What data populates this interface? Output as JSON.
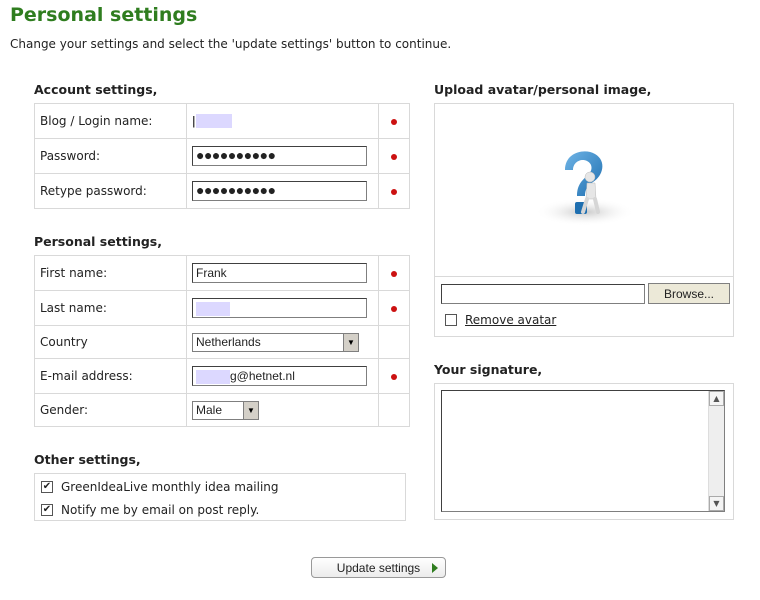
{
  "page": {
    "title": "Personal settings",
    "intro": "Change your settings and select the 'update settings' button to continue."
  },
  "account": {
    "heading": "Account settings,",
    "login_label": "Blog / Login name:",
    "login_value": "",
    "password_label": "Password:",
    "password_value": "●●●●●●●●●●",
    "retype_label": "Retype password:",
    "retype_value": "●●●●●●●●●●"
  },
  "personal": {
    "heading": "Personal settings,",
    "first_name_label": "First name:",
    "first_name_value": "Frank",
    "last_name_label": "Last name:",
    "country_label": "Country",
    "country_value": "Netherlands",
    "email_label": "E-mail address:",
    "email_suffix": "g@hetnet.nl",
    "gender_label": "Gender:",
    "gender_value": "Male"
  },
  "other": {
    "heading": "Other settings,",
    "mailing_label": "GreenIdeaLive monthly idea mailing",
    "mailing_checked": true,
    "notify_label": "Notify me by email on post reply.",
    "notify_checked": true
  },
  "avatar": {
    "heading": "Upload avatar/personal image,",
    "browse_label": "Browse...",
    "remove_label": "Remove avatar"
  },
  "signature": {
    "heading": "Your signature,"
  },
  "actions": {
    "update_label": "Update settings"
  },
  "colors": {
    "title_green": "#2f7d1f",
    "required_red": "#cc1111",
    "redaction": "#dcd8ff"
  }
}
